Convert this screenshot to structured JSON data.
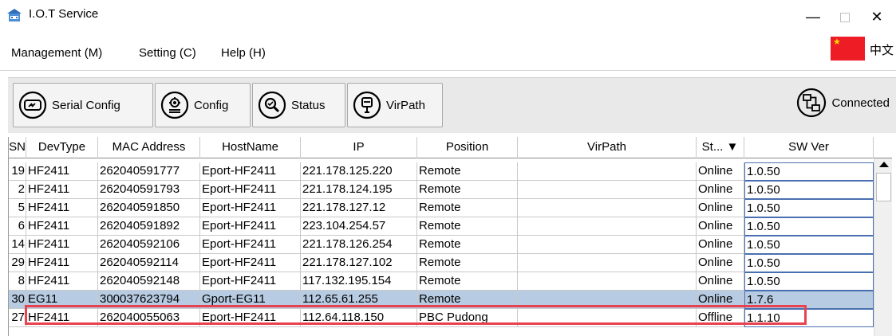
{
  "window": {
    "title": "I.O.T Service",
    "minimize": "—",
    "close": "✕"
  },
  "menu": {
    "items": [
      "Management (M)",
      "Setting (C)",
      "Help (H)"
    ],
    "language": "中文"
  },
  "toolbar": {
    "buttons": [
      {
        "label": "Serial Config",
        "icon": "serial-config-icon"
      },
      {
        "label": "Config",
        "icon": "config-icon"
      },
      {
        "label": "Status",
        "icon": "status-icon"
      },
      {
        "label": "VirPath",
        "icon": "virpath-icon"
      }
    ],
    "connection": {
      "label": "Connected",
      "icon": "network-icon"
    }
  },
  "table": {
    "columns": [
      "SN",
      "DevType",
      "MAC Address",
      "HostName",
      "IP",
      "Position",
      "VirPath",
      "St... ▼",
      "SW Ver"
    ],
    "rows": [
      {
        "sn": "19",
        "devtype": "HF2411",
        "mac": "262040591777",
        "hostname": "Eport-HF2411",
        "ip": "221.178.125.220",
        "position": "Remote",
        "virpath": "",
        "status": "Online",
        "swver": "1.0.50"
      },
      {
        "sn": "2",
        "devtype": "HF2411",
        "mac": "262040591793",
        "hostname": "Eport-HF2411",
        "ip": "221.178.124.195",
        "position": "Remote",
        "virpath": "",
        "status": "Online",
        "swver": "1.0.50"
      },
      {
        "sn": "5",
        "devtype": "HF2411",
        "mac": "262040591850",
        "hostname": "Eport-HF2411",
        "ip": "221.178.127.12",
        "position": "Remote",
        "virpath": "",
        "status": "Online",
        "swver": "1.0.50"
      },
      {
        "sn": "6",
        "devtype": "HF2411",
        "mac": "262040591892",
        "hostname": "Eport-HF2411",
        "ip": "223.104.254.57",
        "position": "Remote",
        "virpath": "",
        "status": "Online",
        "swver": "1.0.50"
      },
      {
        "sn": "14",
        "devtype": "HF2411",
        "mac": "262040592106",
        "hostname": "Eport-HF2411",
        "ip": "221.178.126.254",
        "position": "Remote",
        "virpath": "",
        "status": "Online",
        "swver": "1.0.50"
      },
      {
        "sn": "29",
        "devtype": "HF2411",
        "mac": "262040592114",
        "hostname": "Eport-HF2411",
        "ip": "221.178.127.102",
        "position": "Remote",
        "virpath": "",
        "status": "Online",
        "swver": "1.0.50"
      },
      {
        "sn": "8",
        "devtype": "HF2411",
        "mac": "262040592148",
        "hostname": "Eport-HF2411",
        "ip": "117.132.195.154",
        "position": "Remote",
        "virpath": "",
        "status": "Online",
        "swver": "1.0.50"
      },
      {
        "sn": "30",
        "devtype": "EG11",
        "mac": "300037623794",
        "hostname": "Gport-EG11",
        "ip": "112.65.61.255",
        "position": "Remote",
        "virpath": "",
        "status": "Online",
        "swver": "1.7.6"
      },
      {
        "sn": "27",
        "devtype": "HF2411",
        "mac": "262040055063",
        "hostname": "Eport-HF2411",
        "ip": "112.64.118.150",
        "position": "PBC Pudong",
        "virpath": "",
        "status": "Offline",
        "swver": "1.1.10"
      }
    ],
    "selected_row": 7
  },
  "colors": {
    "selection": "#b7cbe2",
    "highlight_box": "#e8414f",
    "flag": "#ee1c25"
  }
}
